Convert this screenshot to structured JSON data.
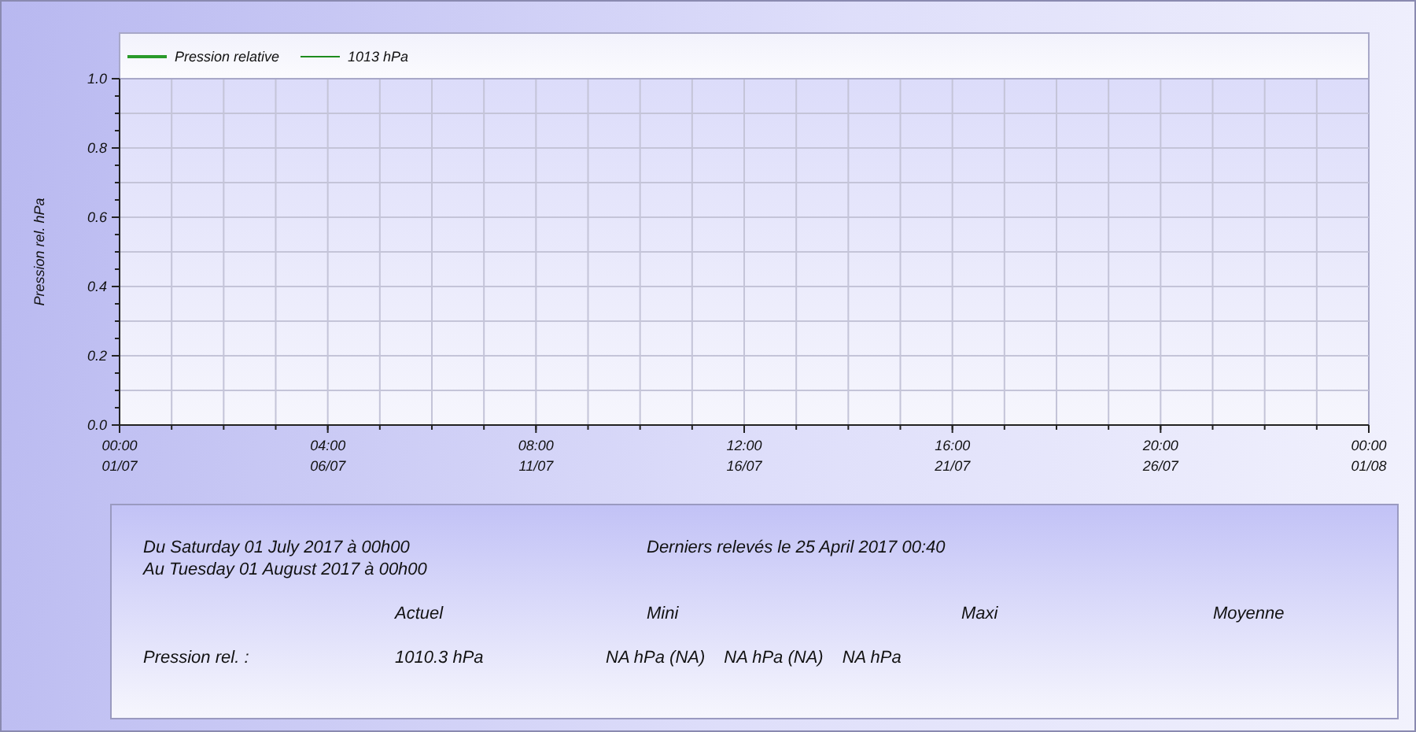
{
  "chart": {
    "chart_data": {
      "type": "line",
      "ylabel": "Pression rel. hPa",
      "ylim": [
        0,
        1
      ],
      "grid": true,
      "categories": [
        "00:00 01/07",
        "04:00 06/07",
        "08:00 11/07",
        "12:00 16/07",
        "16:00 21/07",
        "20:00 26/07",
        "00:00 01/08"
      ],
      "yticks": [
        {
          "value": 0,
          "label": "0.0"
        },
        {
          "value": 0.2,
          "label": "0.2"
        },
        {
          "value": 0.4,
          "label": "0.4"
        },
        {
          "value": 0.6,
          "label": "0.6"
        },
        {
          "value": 0.8,
          "label": "0.8"
        },
        {
          "value": 1,
          "label": "1.0"
        }
      ],
      "series": [
        {
          "name": "Pression relative",
          "color": "#2a9a2a",
          "values": [
            null,
            null,
            null,
            null,
            null,
            null,
            null
          ]
        },
        {
          "name": "1013 hPa",
          "color": "#1e8c1e",
          "values": [
            null,
            null,
            null,
            null,
            null,
            null,
            null
          ]
        }
      ]
    }
  },
  "summary": {
    "period": [
      "Du Saturday 01 July 2017 à 00h00",
      "Au Tuesday 01 August 2017 à 00h00"
    ],
    "last_reading": "Derniers relevés le 25 April 2017 00:40",
    "headers": [
      "Actuel",
      "Mini",
      "Maxi",
      "Moyenne"
    ],
    "rows": [
      {
        "label": "Pression rel. :",
        "values": [
          "1010.3 hPa",
          "NA hPa (NA)",
          "NA hPa (NA)",
          "NA hPa"
        ]
      }
    ]
  }
}
